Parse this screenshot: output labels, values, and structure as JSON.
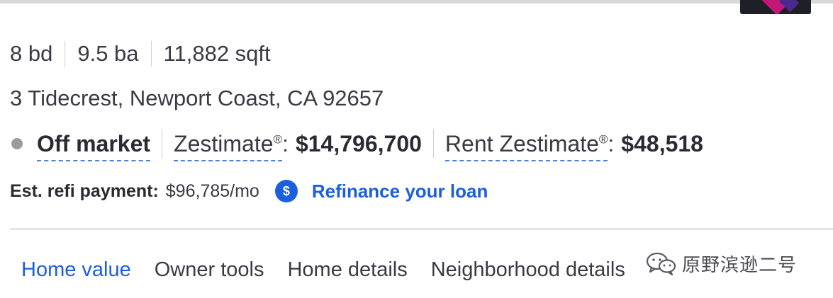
{
  "facts": {
    "beds": "8 bd",
    "baths": "9.5 ba",
    "sqft": "11,882 sqft"
  },
  "address": "3 Tidecrest, Newport Coast, CA 92657",
  "status": {
    "label": "Off market",
    "zestimate_label": "Zestimate",
    "zestimate_value": "$14,796,700",
    "rent_label": "Rent Zestimate",
    "rent_value": "$48,518",
    "registered_mark": "®"
  },
  "refi": {
    "label": "Est. refi payment:",
    "amount": "$96,785/mo",
    "icon": "dollar-icon",
    "icon_glyph": "$",
    "link": "Refinance your loan"
  },
  "tabs": [
    {
      "label": "Home value",
      "active": true
    },
    {
      "label": "Owner tools",
      "active": false
    },
    {
      "label": "Home details",
      "active": false
    },
    {
      "label": "Neighborhood details",
      "active": false
    }
  ],
  "watermark": {
    "text": "原野滨逊二号",
    "icon": "wechat-icon"
  },
  "colors": {
    "accent": "#1a5fe0",
    "text": "#2a2a33",
    "status_dot": "#9a9aa2"
  }
}
